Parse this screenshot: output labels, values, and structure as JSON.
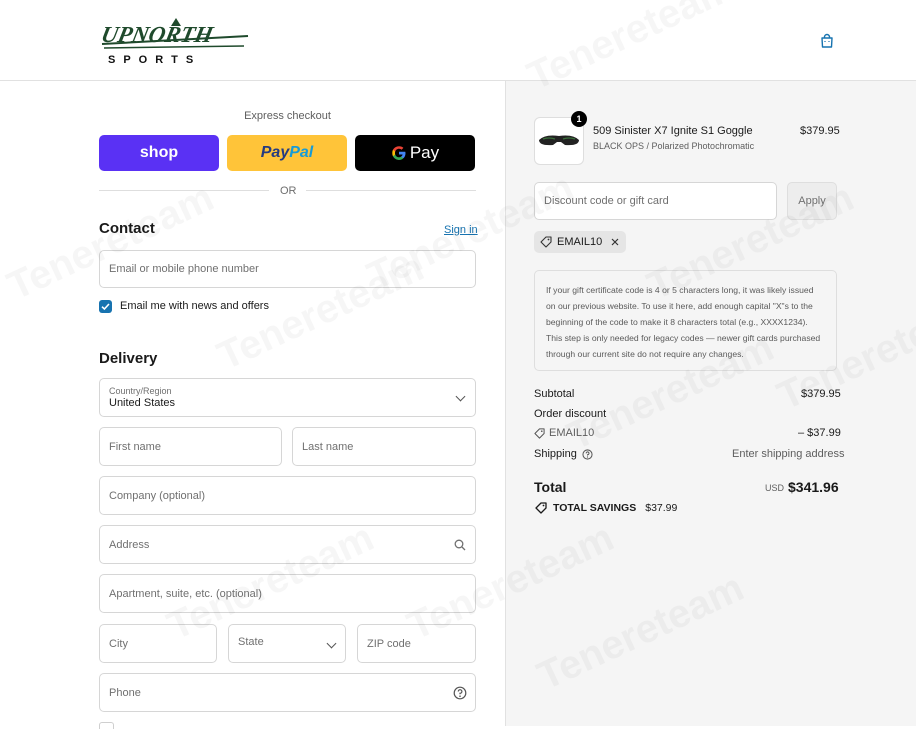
{
  "brand": {
    "logo_text_top": "UPNORTH",
    "logo_text_bottom": "SPORTS"
  },
  "express": {
    "title": "Express checkout",
    "shop_label": "shop",
    "paypal_label_a": "Pay",
    "paypal_label_b": "Pal",
    "gpay_label": "Pay",
    "or": "OR"
  },
  "contact": {
    "heading": "Contact",
    "sign_in": "Sign in",
    "email_placeholder": "Email or mobile phone number",
    "newsletter_label": "Email me with news and offers",
    "newsletter_checked": true
  },
  "delivery": {
    "heading": "Delivery",
    "country_label": "Country/Region",
    "country_value": "United States",
    "first_name": "First name",
    "last_name": "Last name",
    "company": "Company (optional)",
    "address": "Address",
    "apartment": "Apartment, suite, etc. (optional)",
    "city": "City",
    "state": "State",
    "zip": "ZIP code",
    "phone": "Phone"
  },
  "cart": {
    "item": {
      "name": "509 Sinister X7 Ignite S1 Goggle",
      "variant": "BLACK OPS / Polarized Photochromatic",
      "price": "$379.95",
      "quantity": "1"
    },
    "discount_placeholder": "Discount code or gift card",
    "apply": "Apply",
    "applied_code": "EMAIL10",
    "note": "If your gift certificate code is 4 or 5 characters long, it was likely issued on our previous website. To use it here, add enough capital \"X\"s to the beginning of the code to make it 8 characters total (e.g., XXXX1234). This step is only needed for legacy codes — newer gift cards purchased through our current site do not require any changes.",
    "subtotal_label": "Subtotal",
    "subtotal_value": "$379.95",
    "order_discount_label": "Order discount",
    "discount_code": "EMAIL10",
    "discount_value": "– $37.99",
    "shipping_label": "Shipping",
    "shipping_value": "Enter shipping address",
    "total_label": "Total",
    "currency": "USD",
    "total_value": "$341.96",
    "savings_label": "TOTAL SAVINGS",
    "savings_value": "$37.99"
  },
  "watermark": "Tenereteam",
  "colors": {
    "shop": "#5a31f4",
    "paypal": "#ffc439",
    "gpay": "#000000",
    "link": "#1773b0",
    "logo": "#1f4a2c"
  }
}
